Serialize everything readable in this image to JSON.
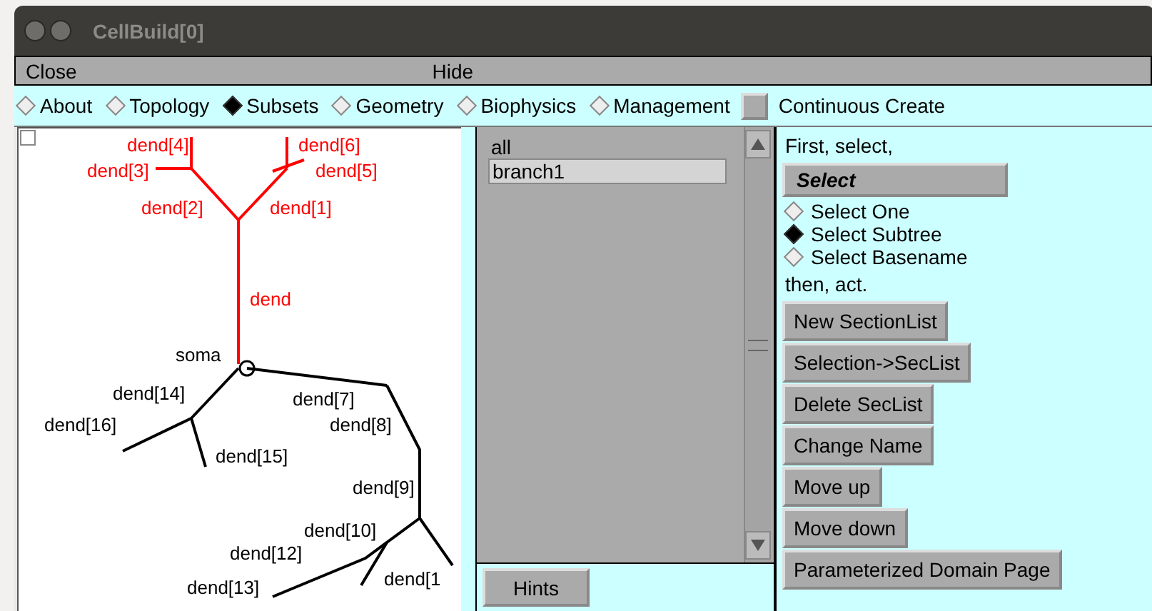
{
  "window": {
    "title": "CellBuild[0]"
  },
  "menu": [
    "Close",
    "Hide"
  ],
  "tabs": [
    {
      "label": "About",
      "selected": false
    },
    {
      "label": "Topology",
      "selected": false
    },
    {
      "label": "Subsets",
      "selected": true
    },
    {
      "label": "Geometry",
      "selected": false
    },
    {
      "label": "Biophysics",
      "selected": false
    },
    {
      "label": "Management",
      "selected": false
    }
  ],
  "continuous_create": {
    "label": "Continuous Create",
    "checked": false
  },
  "shape": {
    "sections": [
      {
        "label": "dend[4]",
        "selected": true
      },
      {
        "label": "dend[6]",
        "selected": true
      },
      {
        "label": "dend[3]",
        "selected": true
      },
      {
        "label": "dend[5]",
        "selected": true
      },
      {
        "label": "dend[2]",
        "selected": true
      },
      {
        "label": "dend[1]",
        "selected": true
      },
      {
        "label": "dend",
        "selected": true
      },
      {
        "label": "soma",
        "selected": false
      },
      {
        "label": "dend[7]",
        "selected": false
      },
      {
        "label": "dend[14]",
        "selected": false
      },
      {
        "label": "dend[8]",
        "selected": false
      },
      {
        "label": "dend[16]",
        "selected": false
      },
      {
        "label": "dend[15]",
        "selected": false
      },
      {
        "label": "dend[9]",
        "selected": false
      },
      {
        "label": "dend[10]",
        "selected": false
      },
      {
        "label": "dend[1",
        "selected": false
      },
      {
        "label": "dend[12]",
        "selected": false
      },
      {
        "label": "dend[13]",
        "selected": false
      }
    ]
  },
  "subsets": {
    "items": [
      {
        "label": "all",
        "selected": false
      },
      {
        "label": "branch1",
        "selected": true
      }
    ]
  },
  "hints_button": "Hints",
  "panel": {
    "intro": "First, select,",
    "select_button": "Select",
    "modes": [
      {
        "label": "Select One",
        "selected": false
      },
      {
        "label": "Select Subtree",
        "selected": true
      },
      {
        "label": "Select Basename",
        "selected": false
      }
    ],
    "then": "then, act.",
    "actions": [
      "New SectionList",
      "Selection->SecList",
      "Delete SecList",
      "Change Name",
      "Move up",
      "Move down",
      "Parameterized Domain Page"
    ]
  }
}
